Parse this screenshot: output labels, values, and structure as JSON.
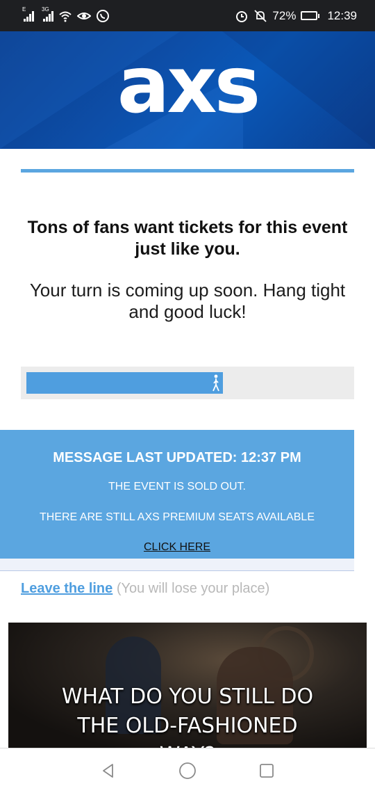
{
  "status_bar": {
    "network_1": "E",
    "network_2": "3G",
    "battery_percent": "72%",
    "battery_level": 0.72,
    "time": "12:39",
    "icons": [
      "signal-icon",
      "wifi-icon",
      "eye-icon",
      "whatsapp-icon",
      "alarm-icon",
      "mute-icon",
      "battery-icon"
    ]
  },
  "header": {
    "logo_text": "axs",
    "background_color": "#0b4fa8"
  },
  "queue": {
    "headline_line1": "Tons of fans want tickets for this event",
    "headline_line2": "just like you.",
    "subline_line1": "Your turn is coming up soon. Hang tight",
    "subline_line2": "and good luck!",
    "progress": 0.61,
    "progress_color": "#4f9edf"
  },
  "notice": {
    "title": "MESSAGE LAST UPDATED: 12:37 PM",
    "line1": "THE EVENT IS SOLD OUT.",
    "line2": "THERE ARE STILL AXS PREMIUM SEATS AVAILABLE",
    "link": "CLICK HERE",
    "background_color": "#5ba6e0"
  },
  "leave": {
    "link_label": "Leave the line",
    "note": "(You will lose your place)"
  },
  "media": {
    "caption_line1": "WHAT DO YOU STILL DO",
    "caption_line2": "THE OLD-FASHIONED",
    "caption_line3": "WAY?"
  },
  "nav": {
    "icons": [
      "back-icon",
      "home-icon",
      "recents-icon"
    ]
  }
}
